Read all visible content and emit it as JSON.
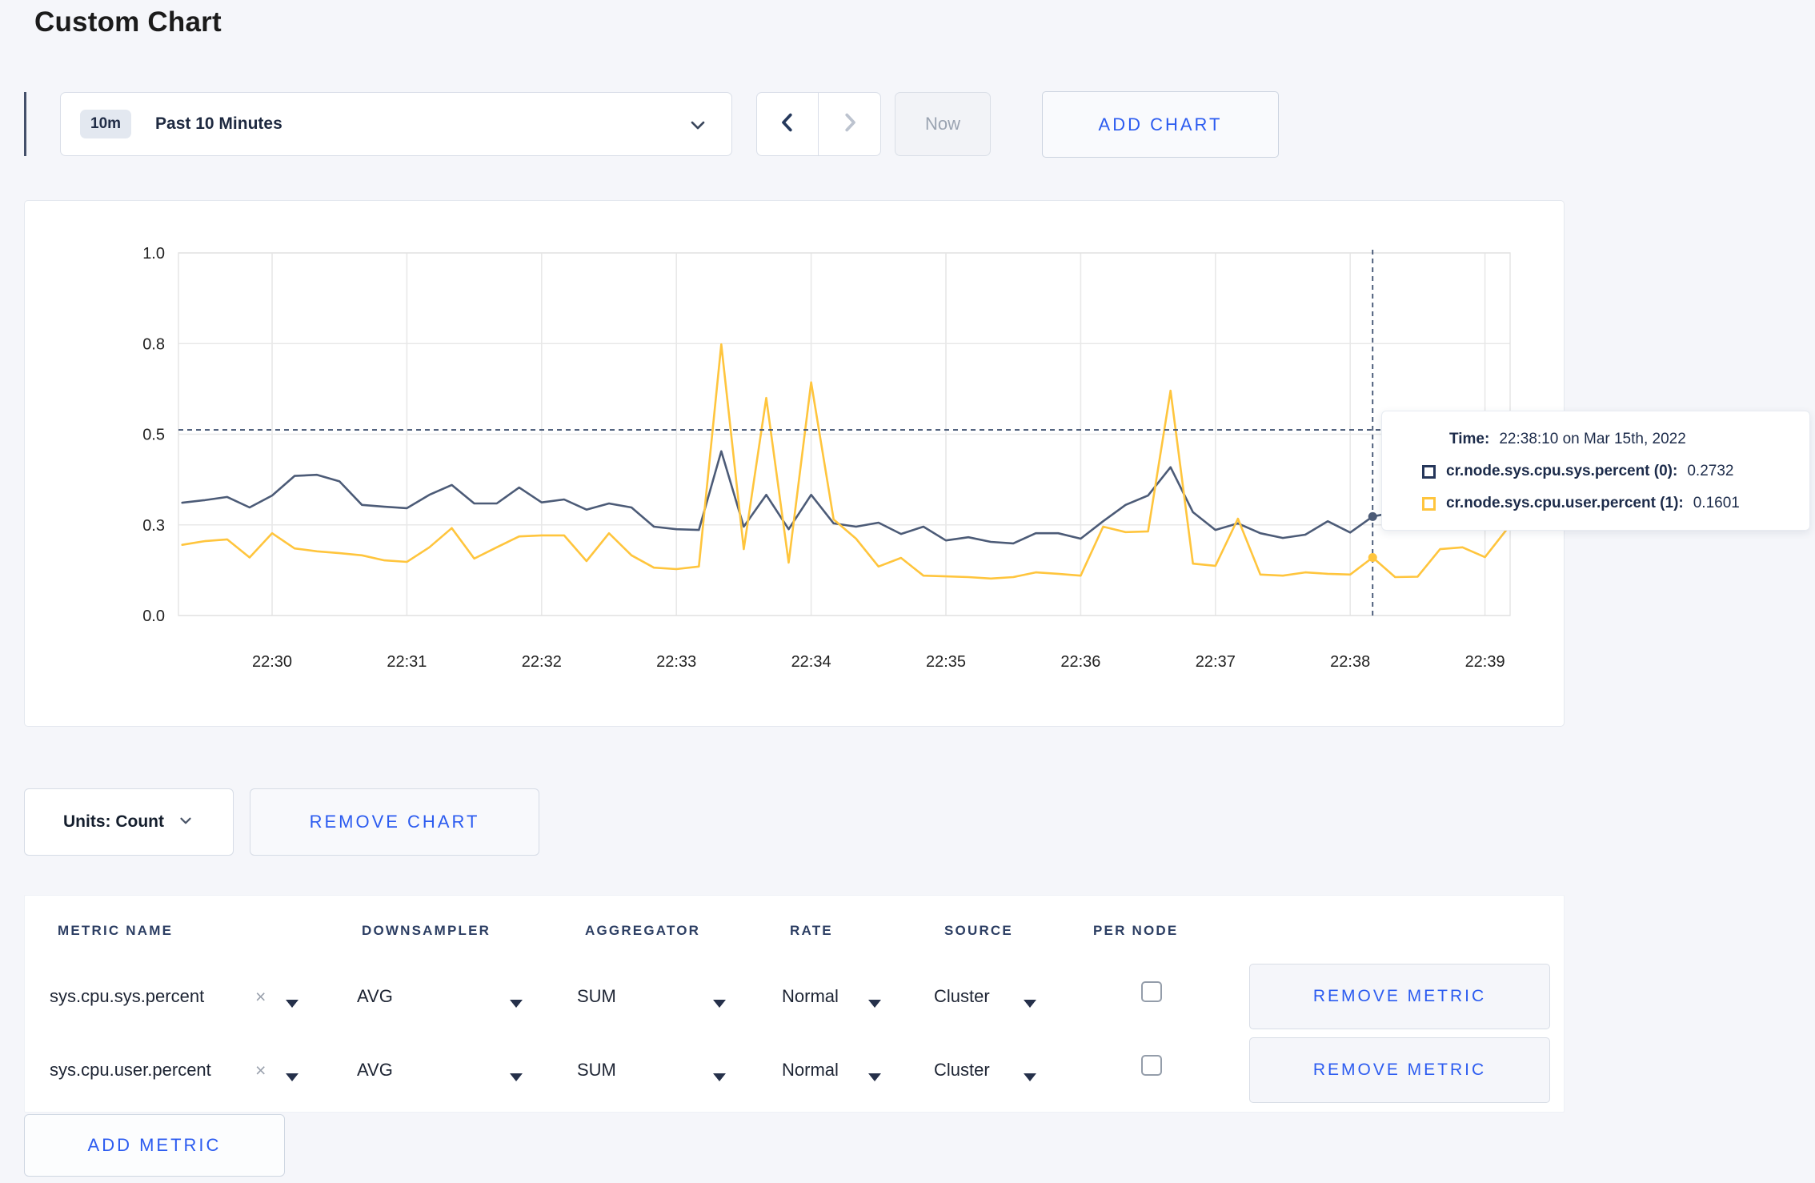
{
  "page": {
    "title": "Custom Chart"
  },
  "toolbar": {
    "range_badge": "10m",
    "range_label": "Past 10 Minutes",
    "now_label": "Now",
    "add_chart_label": "ADD CHART"
  },
  "controls": {
    "units_label": "Units: Count",
    "remove_chart_label": "REMOVE CHART",
    "add_metric_label": "ADD METRIC"
  },
  "tooltip": {
    "time_label": "Time:",
    "time_value": "22:38:10 on Mar 15th, 2022",
    "series": [
      {
        "label": "cr.node.sys.cpu.sys.percent (0):",
        "value": "0.2732",
        "color": "#25365a"
      },
      {
        "label": "cr.node.sys.cpu.user.percent (1):",
        "value": "0.1601",
        "color": "#ffc53d"
      }
    ]
  },
  "metric_table": {
    "headers": [
      "METRIC NAME",
      "DOWNSAMPLER",
      "AGGREGATOR",
      "RATE",
      "SOURCE",
      "PER NODE"
    ],
    "remove_metric_label": "REMOVE METRIC",
    "rows": [
      {
        "metric": "sys.cpu.sys.percent",
        "downsampler": "AVG",
        "aggregator": "SUM",
        "rate": "Normal",
        "source": "Cluster",
        "per_node_checked": false
      },
      {
        "metric": "sys.cpu.user.percent",
        "downsampler": "AVG",
        "aggregator": "SUM",
        "rate": "Normal",
        "source": "Cluster",
        "per_node_checked": false
      }
    ]
  },
  "chart_data": {
    "type": "line",
    "title": "",
    "xlabel": "",
    "ylabel": "",
    "ylim": [
      0,
      1
    ],
    "grid": true,
    "x_start_time": "22:29:20",
    "x_step_sec": 10,
    "x_tick_labels": [
      "22:30",
      "22:31",
      "22:32",
      "22:33",
      "22:34",
      "22:35",
      "22:36",
      "22:37",
      "22:38",
      "22:39"
    ],
    "x_tick_secs": [
      40,
      100,
      160,
      220,
      280,
      340,
      400,
      460,
      520,
      580
    ],
    "y_ticks": [
      {
        "label": "0.0",
        "value": 0
      },
      {
        "label": "0.3",
        "value": 0.25
      },
      {
        "label": "0.5",
        "value": 0.5
      },
      {
        "label": "0.8",
        "value": 0.75
      },
      {
        "label": "1.0",
        "value": 1
      }
    ],
    "series": [
      {
        "name": "cr.node.sys.cpu.sys.percent",
        "color": "#4c5b77",
        "values": [
          0.311,
          0.318,
          0.327,
          0.298,
          0.331,
          0.385,
          0.388,
          0.37,
          0.305,
          0.3,
          0.296,
          0.333,
          0.36,
          0.309,
          0.309,
          0.353,
          0.312,
          0.32,
          0.292,
          0.309,
          0.298,
          0.245,
          0.238,
          0.236,
          0.453,
          0.245,
          0.333,
          0.238,
          0.333,
          0.254,
          0.245,
          0.256,
          0.225,
          0.245,
          0.207,
          0.216,
          0.203,
          0.199,
          0.227,
          0.227,
          0.212,
          0.26,
          0.305,
          0.331,
          0.409,
          0.285,
          0.236,
          0.254,
          0.227,
          0.214,
          0.223,
          0.26,
          0.229,
          0.273,
          0.285,
          0.295,
          0.3,
          0.295,
          0.3,
          0.305
        ]
      },
      {
        "name": "cr.node.sys.cpu.user.percent",
        "color": "#ffc53d",
        "values": [
          0.195,
          0.205,
          0.21,
          0.16,
          0.227,
          0.185,
          0.177,
          0.172,
          0.166,
          0.152,
          0.148,
          0.188,
          0.241,
          0.157,
          0.188,
          0.218,
          0.221,
          0.221,
          0.15,
          0.227,
          0.166,
          0.132,
          0.128,
          0.135,
          0.748,
          0.183,
          0.6,
          0.146,
          0.643,
          0.265,
          0.212,
          0.135,
          0.159,
          0.11,
          0.108,
          0.106,
          0.102,
          0.106,
          0.119,
          0.115,
          0.11,
          0.245,
          0.23,
          0.232,
          0.62,
          0.143,
          0.137,
          0.267,
          0.113,
          0.11,
          0.119,
          0.115,
          0.113,
          0.16,
          0.106,
          0.107,
          0.183,
          0.188,
          0.161,
          0.24
        ]
      }
    ],
    "crosshair": {
      "time_sec": 530,
      "time_label": "22:38:10",
      "hline_value": 0.512
    },
    "legend": "none (values shown in hover tooltip)"
  }
}
